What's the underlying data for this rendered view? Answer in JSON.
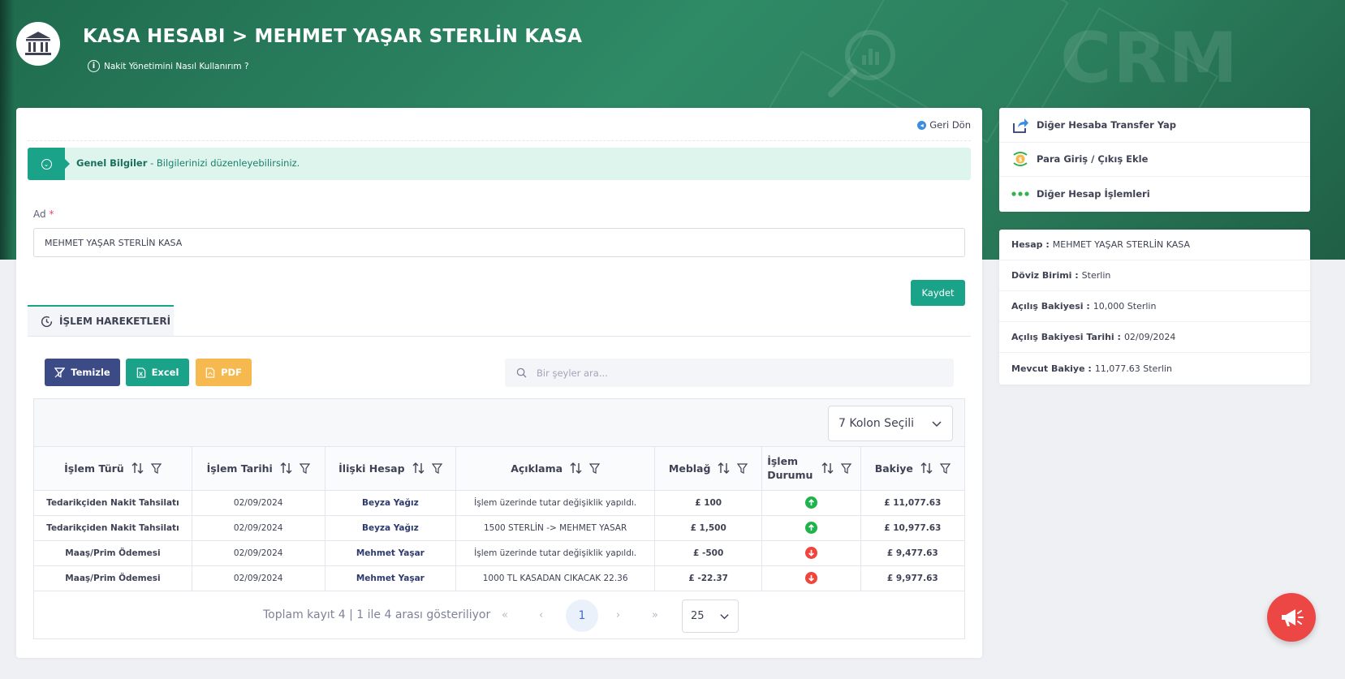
{
  "header": {
    "title": "KASA HESABI > MEHMET YAŞAR STERLİN KASA",
    "help_link": "Nakit Yönetimini Nasıl Kullanırım ?",
    "bg_watermark": "CRM"
  },
  "card": {
    "back_link": "Geri Dön",
    "info_bar": {
      "title": "Genel Bilgiler",
      "subtitle": " - Bilgilerinizi düzenleyebilirsiniz."
    },
    "name_field": {
      "label": "Ad",
      "required_mark": "*",
      "value": "MEHMET YAŞAR STERLİN KASA"
    },
    "save_label": "Kaydet",
    "tab_label": "İŞLEM HAREKETLERİ"
  },
  "toolbar": {
    "clear_label": "Temizle",
    "excel_label": "Excel",
    "pdf_label": "PDF",
    "search_placeholder": "Bir şeyler ara..."
  },
  "grid": {
    "column_selector": "7 Kolon Seçili",
    "columns": [
      "İşlem Türü",
      "İşlem Tarihi",
      "İlişki Hesap",
      "Açıklama",
      "Meblağ",
      "İşlem Durumu",
      "Bakiye"
    ],
    "rows": [
      {
        "type": "Tedarikçiden Nakit Tahsilatı",
        "date": "02/09/2024",
        "relation": "Beyza Yağız",
        "desc": "İşlem üzerinde tutar değişiklik yapıldı.",
        "amount": "£ 100",
        "status": "up",
        "balance": "£ 11,077.63"
      },
      {
        "type": "Tedarikçiden Nakit Tahsilatı",
        "date": "02/09/2024",
        "relation": "Beyza Yağız",
        "desc": "1500 STERLİN -> MEHMET YASAR",
        "amount": "£ 1,500",
        "status": "up",
        "balance": "£ 10,977.63"
      },
      {
        "type": "Maaş/Prim Ödemesi",
        "date": "02/09/2024",
        "relation": "Mehmet Yaşar",
        "desc": "İşlem üzerinde tutar değişiklik yapıldı.",
        "amount": "£ -500",
        "status": "down",
        "balance": "£ 9,477.63"
      },
      {
        "type": "Maaş/Prim Ödemesi",
        "date": "02/09/2024",
        "relation": "Mehmet Yaşar",
        "desc": "1000 TL KASADAN CIKACAK 22.36",
        "amount": "£ -22.37",
        "status": "down",
        "balance": "£ 9,977.63"
      }
    ],
    "pager": {
      "summary": "Toplam kayıt 4 | 1 ile 4 arası gösteriliyor",
      "first": "«",
      "prev": "‹",
      "current_page": "1",
      "next": "›",
      "last": "»",
      "page_size": "25"
    }
  },
  "side_actions": [
    {
      "label": "Diğer Hesaba Transfer Yap",
      "icon": "share-arrow-icon"
    },
    {
      "label": "Para Giriş / Çıkış Ekle",
      "icon": "money-exchange-icon"
    },
    {
      "label": "Diğer Hesap İşlemleri",
      "icon": "dots-icon"
    }
  ],
  "account_info": {
    "account": {
      "label": "Hesap :",
      "value": "MEHMET YAŞAR STERLİN KASA"
    },
    "currency": {
      "label": "Döviz Birimi :",
      "value": "Sterlin"
    },
    "opening_balance": {
      "label": "Açılış Bakiyesi :",
      "value": "10,000 Sterlin"
    },
    "opening_date": {
      "label": "Açılış Bakiyesi Tarihi :",
      "value": "02/09/2024"
    },
    "current_balance": {
      "label": "Mevcut Bakiye :",
      "value": "11,077.63 Sterlin"
    }
  },
  "colors": {
    "primary_green": "#1aa389",
    "navy": "#3c4b85",
    "orange": "#f5b94f",
    "status_up": "#1fb34b",
    "status_down": "#f0443c"
  }
}
